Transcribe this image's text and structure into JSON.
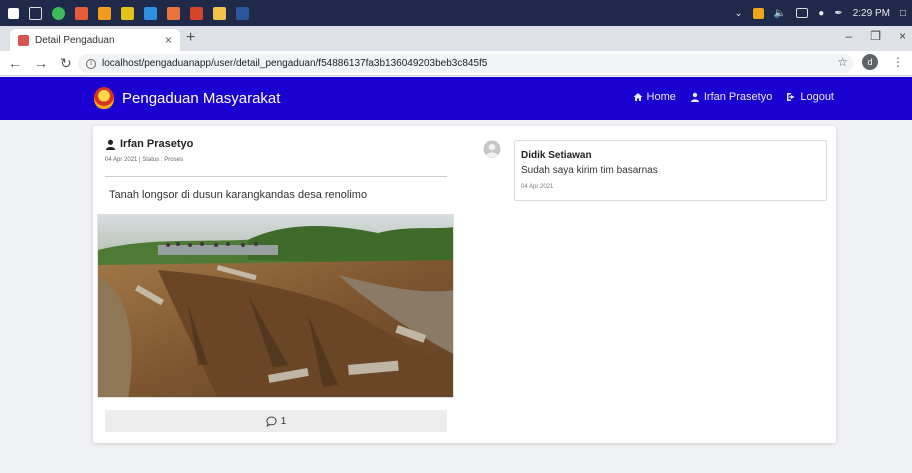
{
  "system": {
    "clock": "2:29 PM"
  },
  "browser": {
    "tab_title": "Detail Pengaduan",
    "url": "localhost/pengaduanapp/user/detail_pengaduan/f54886137fa3b136049203beb3c845f5",
    "profile_initial": "d"
  },
  "navbar": {
    "brand": "Pengaduan Masyarakat",
    "links": [
      {
        "label": "Home",
        "icon": "home-icon"
      },
      {
        "label": "Irfan Prasetyo",
        "icon": "user-icon"
      },
      {
        "label": "Logout",
        "icon": "logout-icon"
      }
    ]
  },
  "post": {
    "author": "Irfan Prasetyo",
    "meta": "04 Apr 2021 | Status : Proses",
    "text": "Tanah longsor di dusun karangkandas desa renolimo",
    "comment_count": "1"
  },
  "reply": {
    "author": "Didik Setiawan",
    "text": "Sudah saya kirim tim basarnas",
    "date": "04 Apr 2021"
  },
  "colors": {
    "navbar": "#1a00d1",
    "page_bg": "#f0f1f4"
  }
}
